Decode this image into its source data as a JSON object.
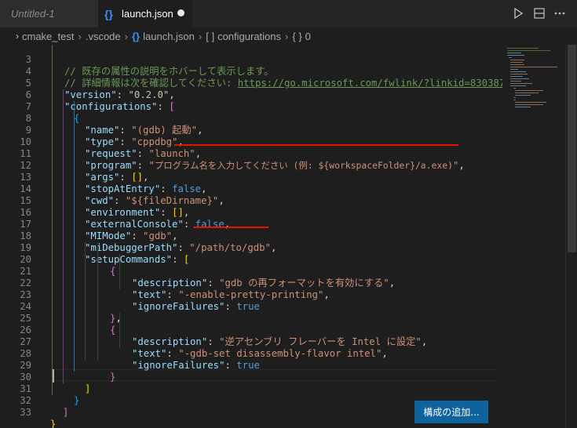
{
  "tabs": [
    {
      "label": "Untitled-1",
      "active": false
    },
    {
      "label": "launch.json",
      "active": true,
      "dirty": true,
      "icon": "json-braces-icon"
    }
  ],
  "titlebar_actions": [
    "run-icon",
    "split-editor-icon",
    "more-actions-icon"
  ],
  "breadcrumb": {
    "folder1": "cmake_test",
    "folder2": ".vscode",
    "file": "launch.json",
    "symbol1": "configurations",
    "symbol2": "0",
    "symbol1_icon": "[ ]",
    "symbol2_icon": "{ }"
  },
  "editor": {
    "line_numbers": [
      "3",
      "4",
      "5",
      "6",
      "7",
      "8",
      "9",
      "10",
      "11",
      "12",
      "13",
      "14",
      "15",
      "16",
      "17",
      "18",
      "19",
      "20",
      "21",
      "22",
      "23",
      "24",
      "25",
      "26",
      "27",
      "28",
      "29",
      "30",
      "31",
      "32",
      "33"
    ],
    "text": {
      "comment1": "// 既存の属性の説明をホバーして表示します。",
      "comment2a": "// 詳細情報は次を確認してください: ",
      "comment2b": "https://go.microsoft.com/fwlink/?linkid=830387",
      "version_key": "\"version\"",
      "version_val": "\"0.2.0\"",
      "configurations_key": "\"configurations\"",
      "name_key": "\"name\"",
      "name_val": "\"(gdb) 起動\"",
      "type_key": "\"type\"",
      "type_val": "\"cppdbg\"",
      "request_key": "\"request\"",
      "request_val": "\"launch\"",
      "program_key": "\"program\"",
      "program_val_q": "\"",
      "program_val": "プログラム名を入力してください (例: ${workspaceFolder}/a.exe)",
      "program_val_end": "\"",
      "args_key": "\"args\"",
      "args_val": "[]",
      "stopAtEntry_key": "\"stopAtEntry\"",
      "stopAtEntry_val": "false",
      "cwd_key": "\"cwd\"",
      "cwd_val": "\"${fileDirname}\"",
      "environment_key": "\"environment\"",
      "environment_val": "[]",
      "externalConsole_key": "\"externalConsole\"",
      "externalConsole_val": "false",
      "MIMode_key": "\"MIMode\"",
      "MIMode_val": "\"gdb\"",
      "miDebuggerPath_key": "\"miDebuggerPath\"",
      "miDebuggerPath_val": "\"/path/to/gdb\"",
      "setupCommands_key": "\"setupCommands\"",
      "description_key": "\"description\"",
      "description1_val": "\"gdb の再フォーマットを有効にする\"",
      "text_key": "\"text\"",
      "text1_val": "\"-enable-pretty-printing\"",
      "ignoreFailures_key": "\"ignoreFailures\"",
      "true_val": "true",
      "description2_val": "\"逆アセンブリ フレーバーを Intel に設定\"",
      "text2_val": "\"-gdb-set disassembly-flavor intel\""
    }
  },
  "add_configuration_button": "構成の追加...",
  "colors": {
    "background": "#1e1e1e",
    "key": "#9cdcfe",
    "string": "#ce9178",
    "keyword": "#569cd6",
    "number_string": "#b5cea8",
    "comment": "#6a9955",
    "bracket_level1": "#ffd700",
    "bracket_level2": "#da70d6",
    "bracket_level3": "#179fff",
    "annotation_underline": "#e51400",
    "button": "#0e639c"
  }
}
